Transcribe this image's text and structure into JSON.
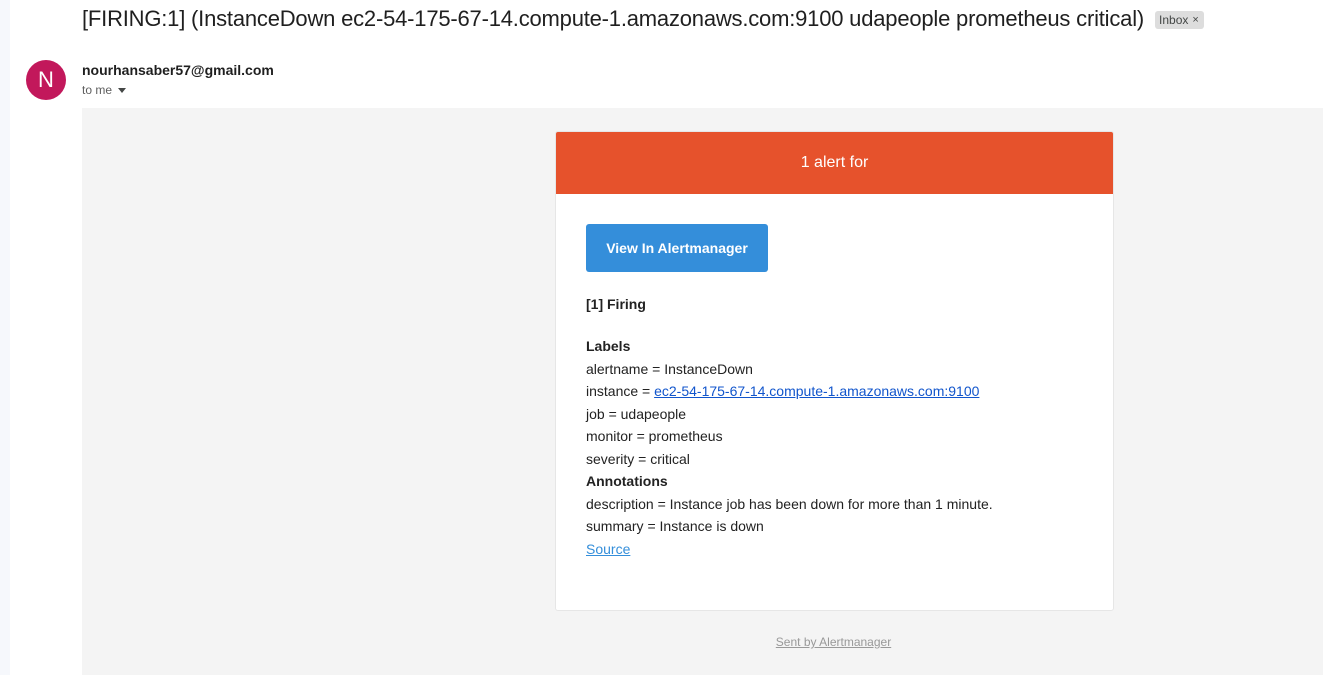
{
  "email": {
    "subject": "[FIRING:1] (InstanceDown ec2-54-175-67-14.compute-1.amazonaws.com:9100 udapeople prometheus critical)",
    "label_chip": "Inbox",
    "label_chip_remove": "×",
    "sender_initial": "N",
    "sender_email": "nourhansaber57@gmail.com",
    "recipient_text": "to me",
    "avatar_color": "#c2185b"
  },
  "alert": {
    "header_text": "1 alert for",
    "header_color": "#e6522c",
    "button_label": "View In Alertmanager",
    "button_color": "#348eda",
    "firing_title": "[1] Firing",
    "labels_heading": "Labels",
    "labels": {
      "alertname": "alertname = InstanceDown",
      "instance_prefix": "instance = ",
      "instance_value": "ec2-54-175-67-14.compute-1.amazonaws.com:9100",
      "job": "job = udapeople",
      "monitor": "monitor = prometheus",
      "severity": "severity = critical"
    },
    "annotations_heading": "Annotations",
    "annotations": {
      "description": "description = Instance job has been down for more than 1 minute.",
      "summary": "summary = Instance is down"
    },
    "source_link": "Source"
  },
  "footer": {
    "text": "Sent by Alertmanager"
  }
}
